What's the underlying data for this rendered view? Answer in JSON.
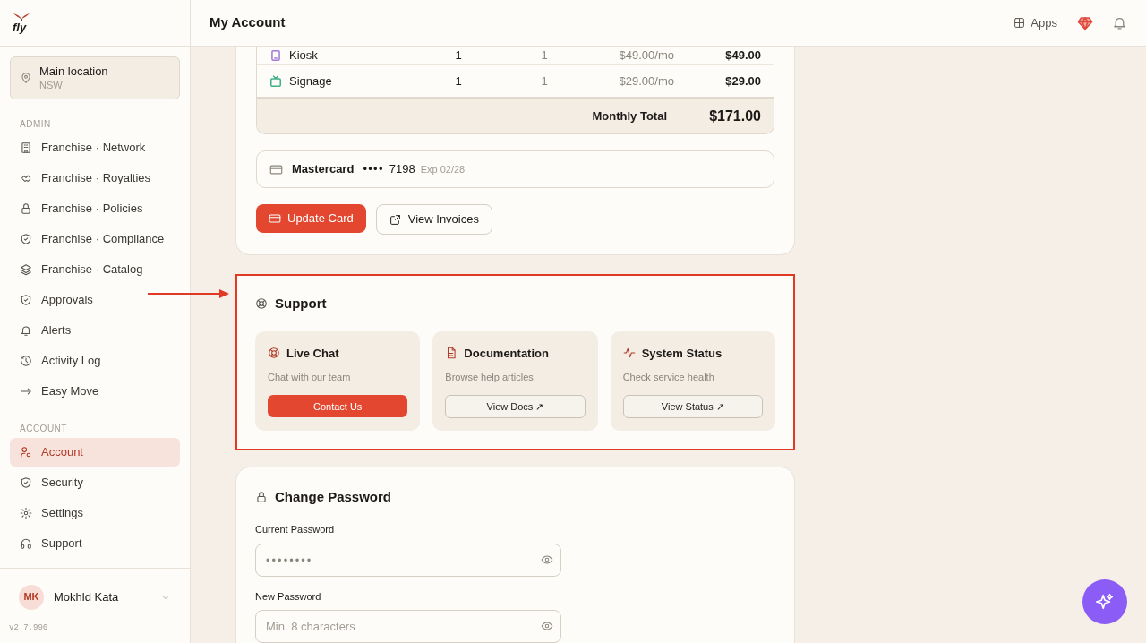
{
  "brand": {
    "name": "fly"
  },
  "location": {
    "name": "Main location",
    "region": "NSW"
  },
  "sidebar": {
    "sections": [
      {
        "heading": "ADMIN",
        "items": [
          {
            "label": "Franchise · Network",
            "selected": false
          },
          {
            "label": "Franchise · Royalties",
            "selected": false
          },
          {
            "label": "Franchise · Policies",
            "selected": false
          },
          {
            "label": "Franchise · Compliance",
            "selected": false
          },
          {
            "label": "Franchise · Catalog",
            "selected": false
          },
          {
            "label": "Approvals",
            "selected": false
          },
          {
            "label": "Alerts",
            "selected": false
          },
          {
            "label": "Activity Log",
            "selected": false
          },
          {
            "label": "Easy Move",
            "selected": false
          }
        ]
      },
      {
        "heading": "ACCOUNT",
        "items": [
          {
            "label": "Account",
            "selected": true
          },
          {
            "label": "Security",
            "selected": false
          },
          {
            "label": "Settings",
            "selected": false
          },
          {
            "label": "Support",
            "selected": false
          }
        ]
      }
    ]
  },
  "user": {
    "initials": "MK",
    "name": "Mokhld Kata"
  },
  "version": "v2.7.996",
  "header": {
    "title": "My Account",
    "apps_label": "Apps"
  },
  "billing": {
    "rows": [
      {
        "name": "Kiosk",
        "color": "#a27ad8",
        "column_2": "1",
        "column_3": "1",
        "price": "$49.00/mo",
        "total": "$49.00"
      },
      {
        "name": "Signage",
        "color": "#3fae8a",
        "column_2": "1",
        "column_3": "1",
        "price": "$29.00/mo",
        "total": "$29.00"
      }
    ],
    "total_label": "Monthly Total",
    "total": "$171.00",
    "card": {
      "brand": "Mastercard",
      "dots": "••••",
      "last4": "7198",
      "expiry": "Exp 02/28"
    },
    "buttons": [
      {
        "label": "Update Card",
        "kind": "primary"
      },
      {
        "label": "View Invoices",
        "kind": "secondary"
      }
    ]
  },
  "support": {
    "title": "Support",
    "highlighted": true,
    "cards": [
      {
        "title": "Live Chat",
        "description": "Chat with our team",
        "button": "Contact Us",
        "kind": "primary"
      },
      {
        "title": "Documentation",
        "description": "Browse help articles",
        "button": "View Docs ↗",
        "kind": "secondary"
      },
      {
        "title": "System Status",
        "description": "Check service health",
        "button": "View Status ↗",
        "kind": "secondary"
      }
    ]
  },
  "password": {
    "title": "Change Password",
    "fields": [
      {
        "label": "Current Password",
        "value": "••••••••"
      },
      {
        "label": "New Password",
        "placeholder": "Min. 8 characters"
      }
    ]
  }
}
